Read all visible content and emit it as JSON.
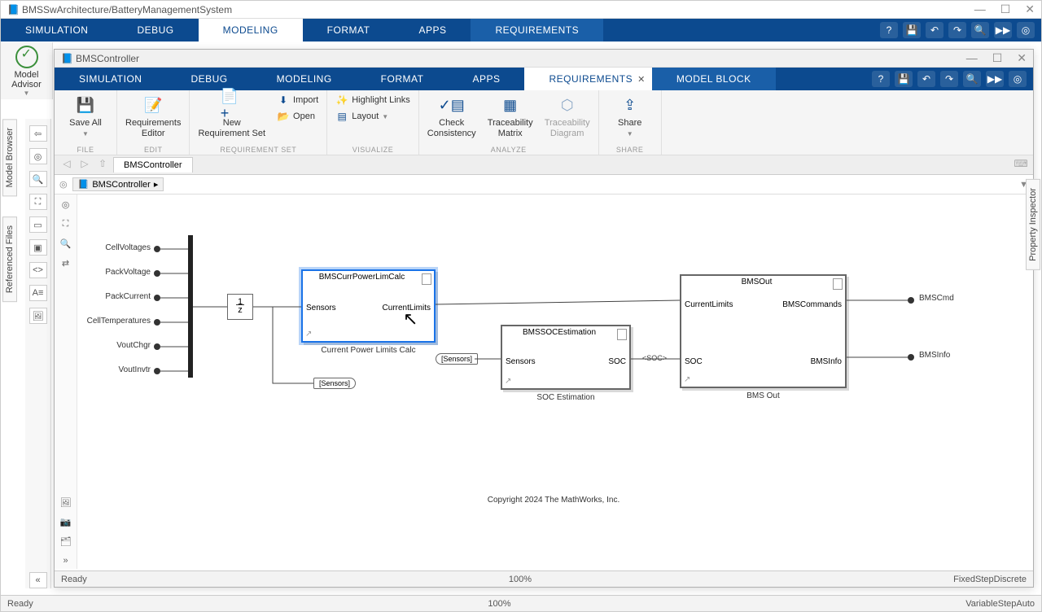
{
  "outer": {
    "title": "BMSSwArchitecture/BatteryManagementSystem",
    "tabs": [
      "SIMULATION",
      "DEBUG",
      "MODELING",
      "FORMAT",
      "APPS",
      "REQUIREMENTS"
    ],
    "active_tab": "MODELING",
    "model_advisor": "Model\nAdvisor",
    "side_model_browser": "Model Browser",
    "side_referenced_files": "Referenced Files",
    "status_ready": "Ready",
    "status_zoom": "100%",
    "status_solver": "VariableStepAuto"
  },
  "inner": {
    "title": "BMSController",
    "tabs": [
      "SIMULATION",
      "DEBUG",
      "MODELING",
      "FORMAT",
      "APPS",
      "REQUIREMENTS",
      "MODEL BLOCK"
    ],
    "active_tab": "REQUIREMENTS",
    "side_referenced_files": "Referenced Files",
    "side_prop_inspector": "Property Inspector",
    "ribbon": {
      "file": {
        "save_all": "Save All",
        "group": "FILE"
      },
      "edit": {
        "req_editor": "Requirements\nEditor",
        "group": "EDIT"
      },
      "reqset": {
        "new_req_set": "New\nRequirement Set",
        "import": "Import",
        "open": "Open",
        "group": "REQUIREMENT SET"
      },
      "visualize": {
        "highlight": "Highlight Links",
        "layout": "Layout",
        "group": "VISUALIZE"
      },
      "analyze": {
        "check": "Check\nConsistency",
        "matrix": "Traceability\nMatrix",
        "diagram": "Traceability\nDiagram",
        "group": "ANALYZE"
      },
      "share": {
        "share": "Share",
        "group": "SHARE"
      }
    },
    "doctab": "BMSController",
    "breadcrumb": "BMSController",
    "status_ready": "Ready",
    "status_zoom": "100%",
    "status_solver": "FixedStepDiscrete"
  },
  "diagram": {
    "inports": [
      "CellVoltages",
      "PackVoltage",
      "PackCurrent",
      "CellTemperatures",
      "VoutChgr",
      "VoutInvtr"
    ],
    "delay_label": "1\n—\nz",
    "block_cplc": {
      "title": "BMSCurrPowerLimCalc",
      "in": "Sensors",
      "out": "CurrentLimits",
      "caption": "Current Power Limits Calc"
    },
    "block_soc": {
      "title": "BMSSOCEstimation",
      "in": "Sensors",
      "out": "SOC",
      "caption": "SOC Estimation"
    },
    "block_out": {
      "title": "BMSOut",
      "in1": "CurrentLimits",
      "in2": "SOC",
      "out1": "BMSCommands",
      "out2": "BMSInfo",
      "caption": "BMS Out"
    },
    "outports": [
      "BMSCmd",
      "BMSInfo"
    ],
    "goto_sensors": "[Sensors]",
    "from_sensors": "[Sensors]",
    "sig_soc": "<SOC>",
    "copyright": "Copyright 2024 The MathWorks, Inc."
  }
}
